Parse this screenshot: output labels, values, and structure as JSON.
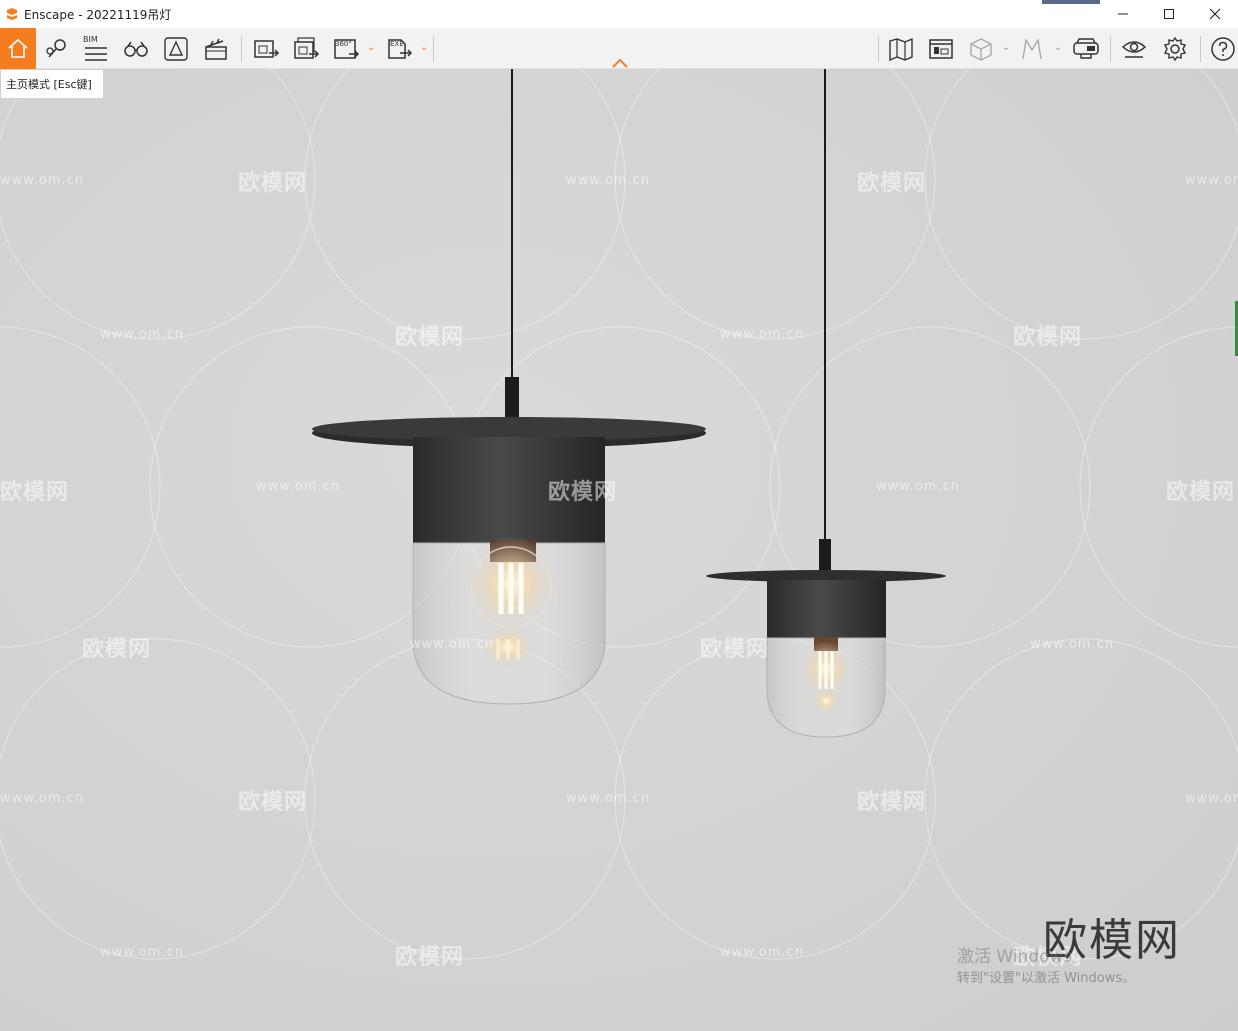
{
  "window": {
    "title": "Enscape - 20221119吊灯",
    "controls": [
      "minimize-icon",
      "maximize-icon",
      "close-icon"
    ]
  },
  "toolbar": {
    "left": [
      {
        "name": "home",
        "icon": "home-icon",
        "active": true
      },
      {
        "name": "views",
        "icon": "location-pin-icon"
      },
      {
        "name": "bim",
        "icon": "bim-icon",
        "label": "BIM"
      },
      {
        "name": "look",
        "icon": "binoculars-icon"
      },
      {
        "name": "asset",
        "icon": "asset-library-icon"
      },
      {
        "name": "video",
        "icon": "clapperboard-icon"
      },
      {
        "name": "render",
        "icon": "screenshot-export-icon"
      },
      {
        "name": "batch",
        "icon": "batch-render-icon"
      },
      {
        "name": "pano",
        "icon": "panorama-icon",
        "label": "360°"
      },
      {
        "name": "exe",
        "icon": "exe-export-icon",
        "label": "EXE"
      }
    ],
    "right": [
      {
        "name": "map",
        "icon": "map-icon"
      },
      {
        "name": "presentation",
        "icon": "presentation-icon"
      },
      {
        "name": "cube",
        "icon": "cube-icon"
      },
      {
        "name": "walk",
        "icon": "walk-icon"
      },
      {
        "name": "vr",
        "icon": "vr-headset-icon"
      },
      {
        "name": "visibility",
        "icon": "eye-icon"
      },
      {
        "name": "settings",
        "icon": "gear-icon"
      },
      {
        "name": "help",
        "icon": "help-icon"
      }
    ],
    "accent": "#f57c1f"
  },
  "tooltip": {
    "text": "主页模式 [Esc键]"
  },
  "watermark": {
    "url": "www.om.cn",
    "brand": "欧模网",
    "logo": "欧模网"
  },
  "activation": {
    "line1": "激活 Windows",
    "line2": "转到\"设置\"以激活 Windows。"
  }
}
